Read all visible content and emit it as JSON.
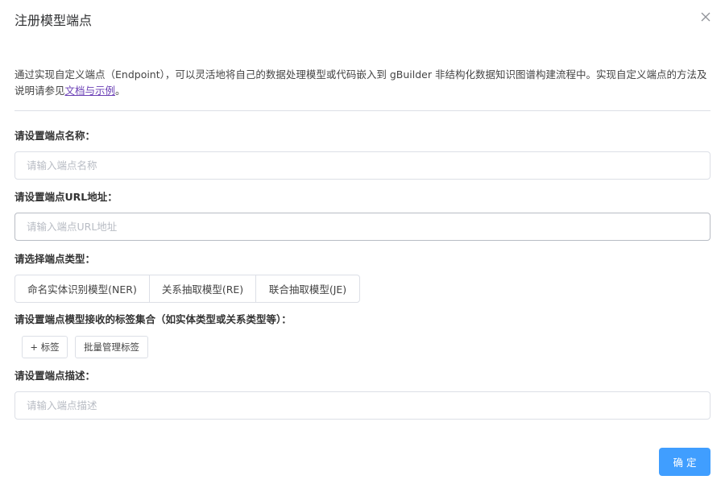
{
  "dialog": {
    "title": "注册模型端点",
    "close_icon": "close-icon"
  },
  "intro": {
    "text": "通过实现自定义端点（Endpoint），可以灵活地将自己的数据处理模型或代码嵌入到 gBuilder 非结构化数据知识图谱构建流程中。实现自定义端点的方法及说明请参见",
    "link_text": "文档与示例",
    "suffix": "。"
  },
  "form": {
    "name": {
      "label": "请设置端点名称：",
      "placeholder": "请输入端点名称",
      "value": ""
    },
    "url": {
      "label": "请设置端点URL地址：",
      "placeholder": "请输入端点URL地址",
      "value": ""
    },
    "type": {
      "label": "请选择端点类型：",
      "options": [
        "命名实体识别模型(NER)",
        "关系抽取模型(RE)",
        "联合抽取模型(JE)"
      ]
    },
    "tags": {
      "label": "请设置端点模型接收的标签集合（如实体类型或关系类型等）：",
      "add_label": "+ 标签",
      "batch_label": "批量管理标签"
    },
    "description": {
      "label": "请设置端点描述：",
      "placeholder": "请输入端点描述",
      "value": ""
    }
  },
  "footer": {
    "confirm_label": "确定"
  },
  "colors": {
    "primary": "#409eff",
    "link": "#6a3fb5",
    "border": "#dcdfe6"
  }
}
